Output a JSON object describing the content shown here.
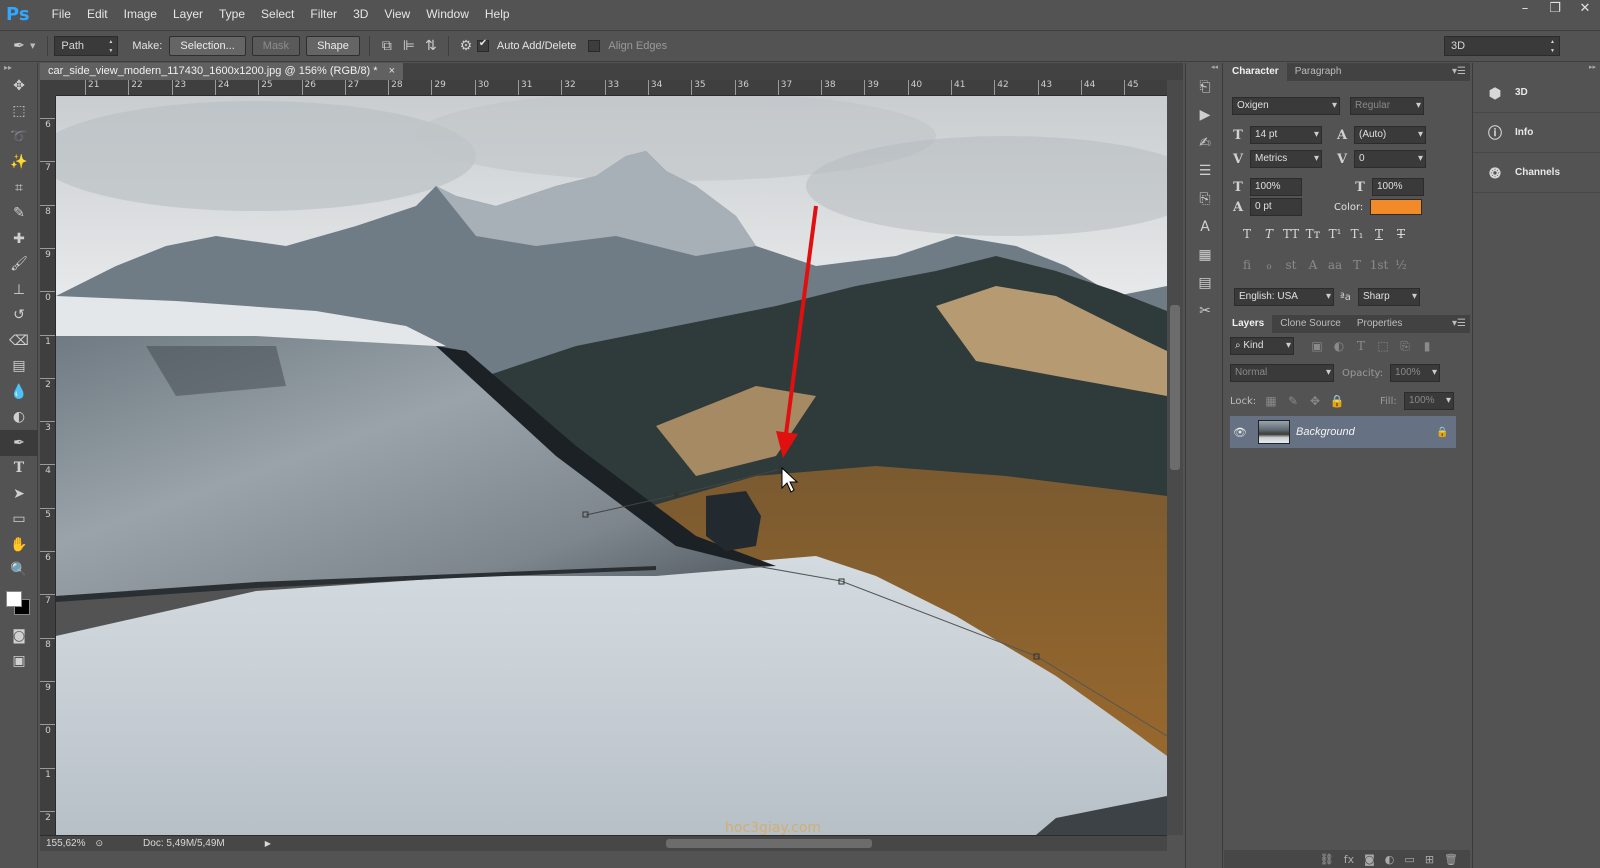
{
  "app": {
    "logo": "Ps"
  },
  "menu": [
    "File",
    "Edit",
    "Image",
    "Layer",
    "Type",
    "Select",
    "Filter",
    "3D",
    "View",
    "Window",
    "Help"
  ],
  "window_controls": {
    "minimize": "–",
    "restore": "❐",
    "close": "✕"
  },
  "options": {
    "mode": "Path",
    "make_label": "Make:",
    "selection_btn": "Selection...",
    "mask_btn": "Mask",
    "shape_btn": "Shape",
    "auto_add_delete": "Auto Add/Delete",
    "auto_add_delete_checked": true,
    "align_edges": "Align Edges",
    "align_edges_checked": false,
    "workspace": "3D"
  },
  "document": {
    "tab_title": "car_side_view_modern_117430_1600x1200.jpg @ 156% (RGB/8) *",
    "close": "×",
    "ruler_h": [
      "21",
      "22",
      "23",
      "24",
      "25",
      "26",
      "27",
      "28",
      "29",
      "30",
      "31",
      "32",
      "33",
      "34",
      "35",
      "36",
      "37",
      "38",
      "39",
      "40",
      "41",
      "42",
      "43",
      "44",
      "45"
    ],
    "ruler_v": [
      "6",
      "7",
      "8",
      "9",
      "0",
      "1",
      "2",
      "3",
      "4",
      "5",
      "6",
      "7",
      "8",
      "9",
      "0",
      "1",
      "2"
    ],
    "zoom": "155,62%",
    "doc_size": "Doc: 5,49M/5,49M",
    "watermark": "hoc3giay.com"
  },
  "character": {
    "tabs": [
      "Character",
      "Paragraph"
    ],
    "font_family": "Oxigen",
    "font_style": "Regular",
    "font_size": "14 pt",
    "leading": "(Auto)",
    "kerning": "Metrics",
    "tracking": "0",
    "vscale": "100%",
    "hscale": "100%",
    "baseline": "0 pt",
    "color_label": "Color:",
    "color_value": "#f28a2a",
    "style_buttons": [
      "T",
      "T",
      "TT",
      "Tт",
      "T¹",
      "T₁",
      "T",
      "T"
    ],
    "opentype_buttons": [
      "fi",
      "ℴ",
      "st",
      "A",
      "aa",
      "T",
      "1st",
      "½"
    ],
    "language": "English: USA",
    "antialias_icon": "ªa",
    "antialias": "Sharp"
  },
  "layers": {
    "tabs": [
      "Layers",
      "Clone Source",
      "Properties"
    ],
    "filter_kind": "Kind",
    "blend_mode": "Normal",
    "opacity_label": "Opacity:",
    "opacity": "100%",
    "lock_label": "Lock:",
    "fill_label": "Fill:",
    "fill": "100%",
    "items": [
      {
        "name": "Background",
        "visible": true,
        "locked": true
      }
    ]
  },
  "right_dock": [
    {
      "icon": "cube-icon",
      "label": "3D"
    },
    {
      "icon": "info-icon",
      "label": "Info"
    },
    {
      "icon": "channels-icon",
      "label": "Channels"
    }
  ],
  "colors": {
    "accent_ps": "#31a8ff",
    "arrow": "#e01010",
    "layer_selected": "#667183"
  }
}
